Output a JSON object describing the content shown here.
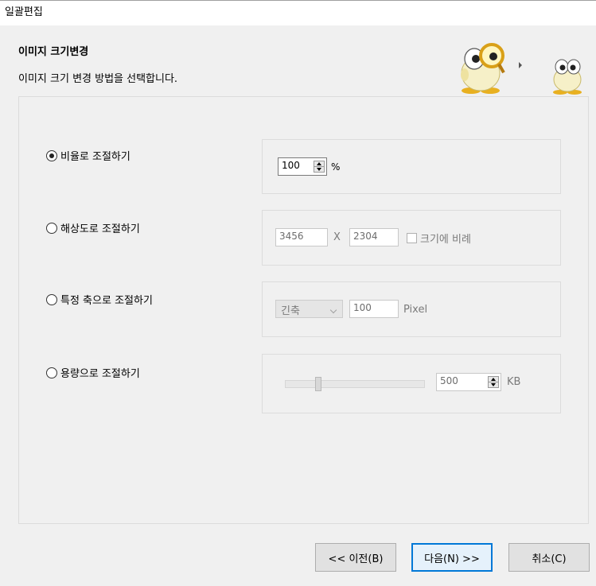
{
  "window": {
    "title": "일괄편집"
  },
  "header": {
    "title": "이미지 크기변경",
    "subtitle": "이미지 크기 변경 방법을 선택합니다."
  },
  "icons": {
    "mascot_large": "mascot-with-magnifier-icon",
    "step_arrow": "chevron-right-icon",
    "mascot_small": "mascot-icon"
  },
  "options": {
    "ratio": {
      "label": "비율로 조절하기",
      "selected": true,
      "value": "100",
      "unit": "%"
    },
    "resolution": {
      "label": "해상도로 조절하기",
      "selected": false,
      "width": "3456",
      "separator": "X",
      "height": "2304",
      "proportional_label": "크기에 비례",
      "proportional_checked": false
    },
    "axis": {
      "label": "특정 축으로 조절하기",
      "selected": false,
      "axis_value": "긴축",
      "size": "100",
      "unit": "Pixel"
    },
    "filesize": {
      "label": "용량으로 조절하기",
      "selected": false,
      "value": "500",
      "unit": "KB"
    }
  },
  "buttons": {
    "prev": "<< 이전(B)",
    "next": "다음(N) >>",
    "cancel": "취소(C)"
  },
  "colors": {
    "accent": "#0078d7",
    "background": "#f0f0f0"
  }
}
